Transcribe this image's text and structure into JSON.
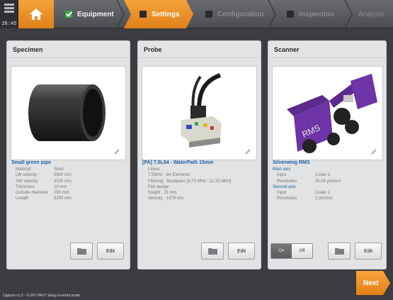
{
  "device": {
    "time": "26:45"
  },
  "nav": {
    "steps": [
      {
        "label": "Equipment",
        "state": "done"
      },
      {
        "label": "Settings",
        "state": "active"
      },
      {
        "label": "Configuration",
        "state": "todo"
      },
      {
        "label": "Inspection",
        "state": "todo"
      },
      {
        "label": "Analysis",
        "state": "todo"
      }
    ],
    "colors": {
      "accent": "#f08c22",
      "done": "#3aa64a"
    }
  },
  "specimen": {
    "header": "Specimen",
    "name": "Small green pipe",
    "properties": [
      {
        "key": "Material",
        "value": "Steel"
      },
      {
        "key": "LW velocity",
        "value": "5900 m/s"
      },
      {
        "key": "SW velocity",
        "value": "3230 m/s"
      },
      {
        "key": "Thickness",
        "value": "10 mm"
      },
      {
        "key": "Outside diameter",
        "value": "150 mm"
      },
      {
        "key": "Length",
        "value": "5200 mm"
      }
    ],
    "edit_label": "Edit"
  },
  "probe": {
    "header": "Probe",
    "name": "[PA] 7.5L64 - WaterPath 15mm",
    "lines": [
      "Linear",
      "7.5MHz - 64 Elements",
      "Filtering : Bandpass [3.75 MHz : 11.25 MHz]",
      "Flat wedge",
      "Height : 15 mm",
      "Velocity : 1479 m/s"
    ],
    "edit_label": "Edit"
  },
  "scanner": {
    "header": "Scanner",
    "name": "Silverwing RMS",
    "main_axis_label": "Main axis",
    "main_axis": [
      {
        "key": "Input",
        "value": "Coder 2"
      },
      {
        "key": "Resolution",
        "value": "30.05 pts/mm"
      }
    ],
    "second_axis_label": "Second axis",
    "second_axis": [
      {
        "key": "Input",
        "value": "Coder 1"
      },
      {
        "key": "Resolution",
        "value": "2 pts/mm"
      }
    ],
    "toggle": {
      "on": "On",
      "off": "Off",
      "selected": "On"
    },
    "edit_label": "Edit"
  },
  "footer": {
    "next_label": "Next",
    "status": "Capture v1.0 - IS.WV PAUT Setup inverted probe"
  }
}
